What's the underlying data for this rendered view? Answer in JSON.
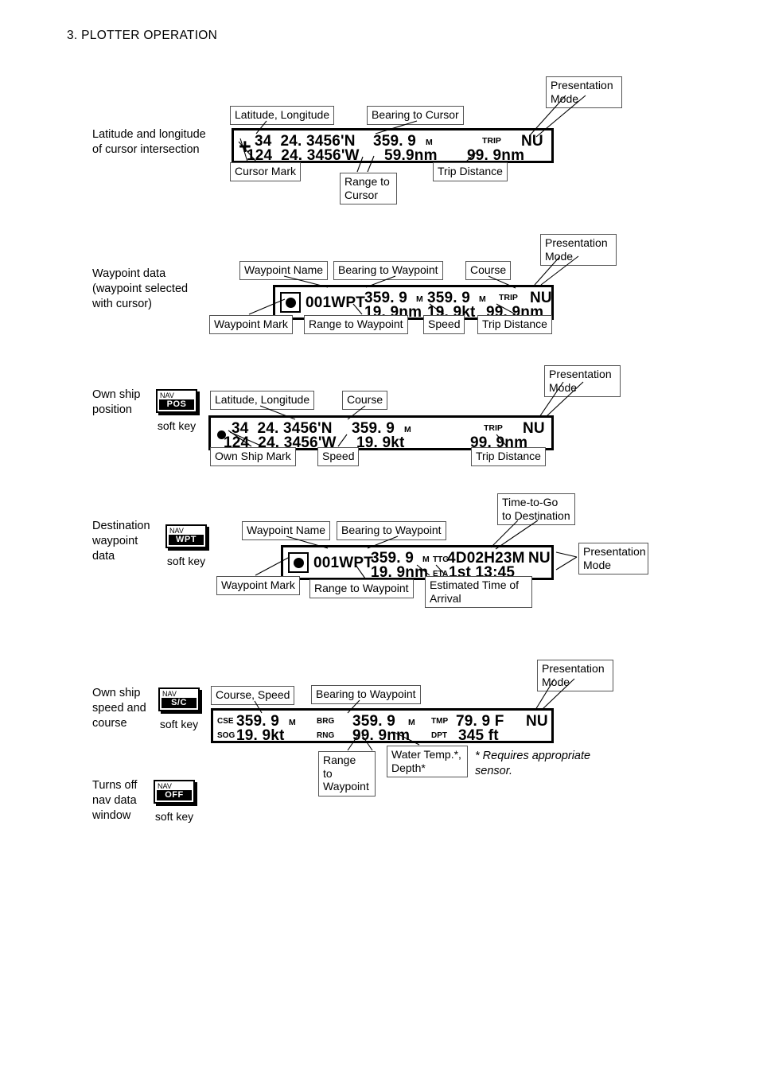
{
  "page": {
    "header": "3. PLOTTER OPERATION"
  },
  "sections": [
    {
      "id": "cursor",
      "description": "Latitude and longitude\nof cursor intersection",
      "softkey": null,
      "display": {
        "mark": "cursor-cross",
        "line1_lat": "34  24. 3456'N",
        "line2_lon": "124  24. 3456'W",
        "bearing": "359. 9",
        "bearing_unit": "M",
        "range": "59.9nm",
        "trip_label": "TRIP",
        "trip_value": "99. 9nm",
        "mode": "NU"
      },
      "callouts": {
        "lat_lon": "Latitude, Longitude",
        "bearing_to_cursor": "Bearing to Cursor",
        "presentation_mode": "Presentation\nMode",
        "cursor_mark": "Cursor Mark",
        "range_to_cursor": "Range to\nCursor",
        "trip_distance": "Trip Distance"
      }
    },
    {
      "id": "waypoint-data",
      "description": "Waypoint data\n(waypoint selected\nwith cursor)",
      "softkey": null,
      "display": {
        "mark": "waypoint",
        "name": "001WPT",
        "bearing": "359. 9",
        "bearing_unit": "M",
        "course": "359. 9",
        "course_unit": "M",
        "range": "19. 9nm",
        "speed": "19. 9kt",
        "trip_label": "TRIP",
        "trip_value": "99. 9nm",
        "mode": "NU"
      },
      "callouts": {
        "waypoint_name": "Waypoint Name",
        "bearing_to_waypoint": "Bearing to Waypoint",
        "course": "Course",
        "presentation_mode": "Presentation\nMode",
        "waypoint_mark": "Waypoint Mark",
        "range_to_waypoint": "Range to Waypoint",
        "speed": "Speed",
        "trip_distance": "Trip Distance"
      }
    },
    {
      "id": "own-ship-position",
      "description": "Own ship\nposition",
      "softkey": {
        "top": "NAV",
        "bottom": "POS",
        "caption": "soft key"
      },
      "display": {
        "mark": "own-ship-dot",
        "line1_lat": "34  24. 3456'N",
        "line2_lon": "124  24. 3456'W",
        "course": "359. 9",
        "course_unit": "M",
        "speed": "19. 9kt",
        "trip_label": "TRIP",
        "trip_value": "99. 9nm",
        "mode": "NU"
      },
      "callouts": {
        "lat_lon": "Latitude, Longitude",
        "course": "Course",
        "presentation_mode": "Presentation\nMode",
        "own_ship_mark": "Own Ship Mark",
        "speed": "Speed",
        "trip_distance": "Trip Distance"
      }
    },
    {
      "id": "destination-waypoint",
      "description": "Destination\nwaypoint\ndata",
      "softkey": {
        "top": "NAV",
        "bottom": "WPT",
        "caption": "soft key"
      },
      "display": {
        "mark": "waypoint",
        "name": "001WPT",
        "bearing": "359. 9",
        "bearing_unit": "M",
        "ttg_label": "TTG",
        "ttg_value": "4D02H23M",
        "range": "19. 9nm",
        "eta_label": "ETA",
        "eta_value": "1st 13:45",
        "mode": "NU"
      },
      "callouts": {
        "waypoint_name": "Waypoint Name",
        "bearing_to_waypoint": "Bearing to Waypoint",
        "time_to_go": "Time-to-Go\nto Destination",
        "presentation_mode": "Presentation\nMode",
        "waypoint_mark": "Waypoint Mark",
        "range_to_waypoint": "Range to Waypoint",
        "eta": "Estimated Time of\nArrival"
      }
    },
    {
      "id": "own-ship-speed-course",
      "description": "Own ship\nspeed and\ncourse",
      "softkey": {
        "top": "NAV",
        "bottom": "S/C",
        "caption": "soft key"
      },
      "display": {
        "cse_label": "CSE",
        "cse_value": "359. 9",
        "cse_unit": "M",
        "sog_label": "SOG",
        "sog_value": "19. 9kt",
        "brg_label": "BRG",
        "brg_value": "359. 9",
        "brg_unit": "M",
        "rng_label": "RNG",
        "rng_value": "99. 9nm",
        "tmp_label": "TMP",
        "tmp_value": "79. 9 F",
        "dpt_label": "DPT",
        "dpt_value": "345 ft",
        "mode": "NU"
      },
      "callouts": {
        "course_speed": "Course, Speed",
        "bearing_to_waypoint": "Bearing to Waypoint",
        "presentation_mode": "Presentation\nMode",
        "range_to_waypoint": "Range\nto\nWaypoint",
        "water_temp_depth": "Water Temp.*,\nDepth*"
      },
      "footnote": "* Requires appropriate\n   sensor."
    },
    {
      "id": "nav-off",
      "description": "Turns off\nnav data\nwindow",
      "softkey": {
        "top": "NAV",
        "bottom": "OFF",
        "caption": "soft key"
      },
      "display": null,
      "callouts": {}
    }
  ]
}
